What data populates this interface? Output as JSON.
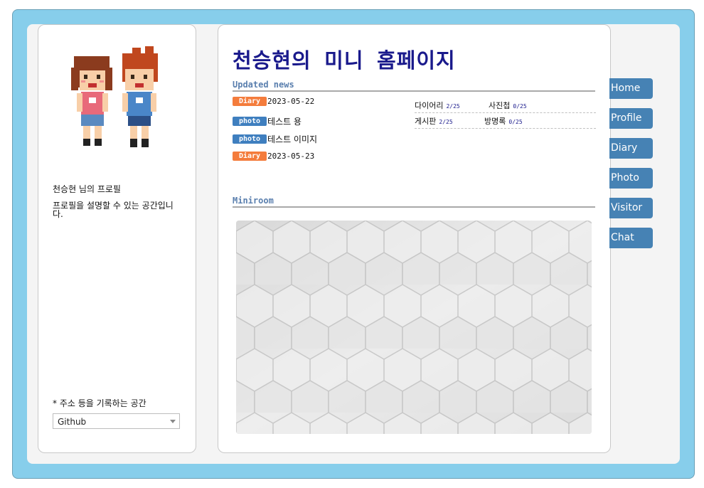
{
  "title": "천승현의 미니 홈페이지",
  "profile": {
    "name_line": "천승현 님의 프로필",
    "description": "프로필을 설명할 수 있는 공간입니다.",
    "address_label": "* 주소 등을 기록하는 공간",
    "address_select_value": "Github"
  },
  "news": {
    "heading": "Updated news",
    "items": [
      {
        "badge": "Diary",
        "text": "2023-05-22"
      },
      {
        "badge": "photo",
        "text": "테스트 용"
      },
      {
        "badge": "photo",
        "text": "테스트 이미지"
      },
      {
        "badge": "Diary",
        "text": "2023-05-23"
      }
    ]
  },
  "stats": [
    {
      "label": "다이어리",
      "count": "2/25"
    },
    {
      "label": "사진첩",
      "count": "0/25"
    },
    {
      "label": "게시판",
      "count": "2/25"
    },
    {
      "label": "방명록",
      "count": "0/25"
    }
  ],
  "miniroom": {
    "heading": "Miniroom"
  },
  "nav": [
    "Home",
    "Profile",
    "Diary",
    "Photo",
    "Visitor",
    "Chat"
  ],
  "colors": {
    "frame": "#87ceeb",
    "title": "#1a1a8c",
    "nav": "#4682b4",
    "diary_badge": "#f47c3c",
    "photo_badge": "#3f7fbf"
  }
}
